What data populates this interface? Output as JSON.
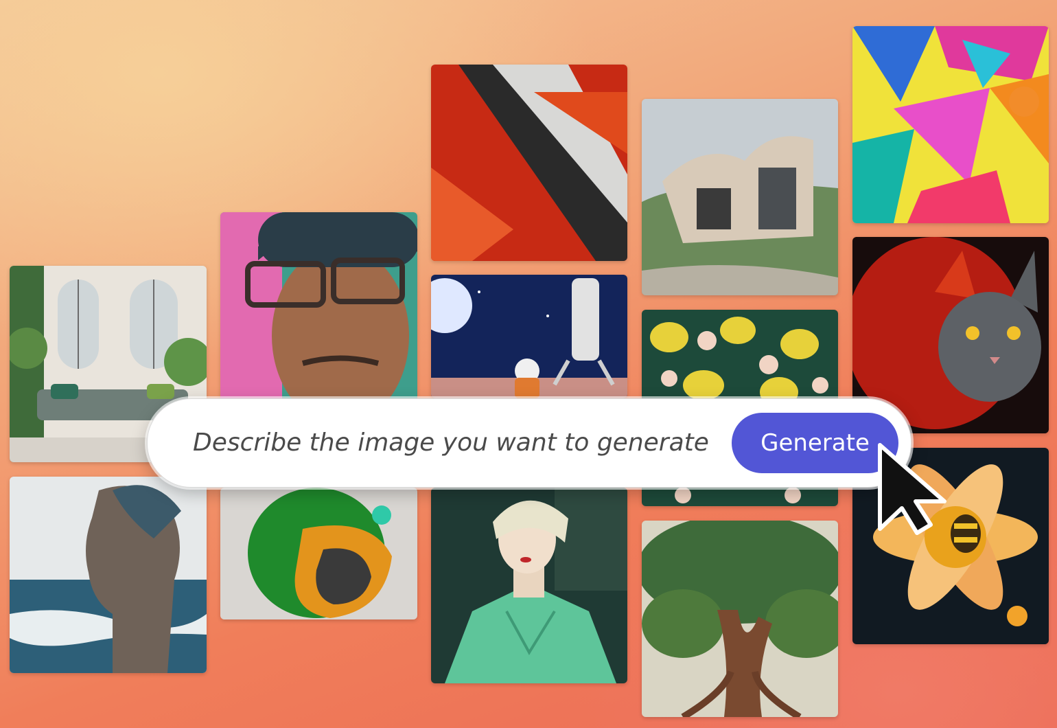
{
  "prompt": {
    "placeholder": "Describe the image you want to generate",
    "button_label": "Generate",
    "button_color": "#5256d6"
  },
  "gallery": {
    "images": [
      {
        "subject": "interior living room with plants"
      },
      {
        "subject": "double exposure portrait with ocean"
      },
      {
        "subject": "portrait of man with glasses and beanie"
      },
      {
        "subject": "abstract green and orange 3D shape"
      },
      {
        "subject": "abstract red and grey palette knife painting"
      },
      {
        "subject": "astronaut on moon with rocket"
      },
      {
        "subject": "art deco woman in green dress"
      },
      {
        "subject": "modern curved architecture house"
      },
      {
        "subject": "lemon and flower pattern"
      },
      {
        "subject": "tree with roots illustration"
      },
      {
        "subject": "colorful geometric paper shapes"
      },
      {
        "subject": "fiery red and grey cat"
      },
      {
        "subject": "bee on orange flower"
      }
    ]
  },
  "icons": {
    "cursor": "arrow-cursor-icon"
  }
}
